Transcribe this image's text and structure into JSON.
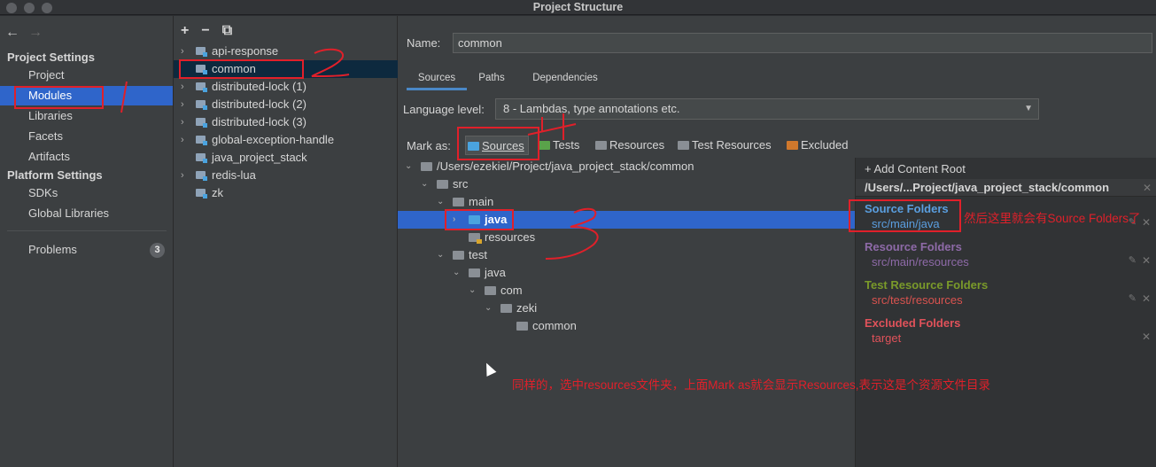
{
  "window": {
    "title": "Project Structure"
  },
  "nav": {
    "back": "←",
    "forward": "→",
    "project_settings_heading": "Project Settings",
    "project_settings": [
      "Project",
      "Modules",
      "Libraries",
      "Facets",
      "Artifacts"
    ],
    "selected": "Modules",
    "platform_settings_heading": "Platform Settings",
    "platform_settings": [
      "SDKs",
      "Global Libraries"
    ],
    "problems_label": "Problems",
    "problems_count": "3"
  },
  "modules": {
    "toolbar": {
      "add": "+",
      "remove": "−",
      "copy": "⧉"
    },
    "items": [
      {
        "label": "api-response",
        "expandable": true
      },
      {
        "label": "common",
        "expandable": false,
        "selected": true
      },
      {
        "label": "distributed-lock (1)",
        "expandable": true
      },
      {
        "label": "distributed-lock (2)",
        "expandable": true
      },
      {
        "label": "distributed-lock (3)",
        "expandable": true
      },
      {
        "label": "global-exception-handle",
        "expandable": true
      },
      {
        "label": "java_project_stack",
        "expandable": false
      },
      {
        "label": "redis-lua",
        "expandable": true
      },
      {
        "label": "zk",
        "expandable": false
      }
    ]
  },
  "module_detail": {
    "name_label": "Name:",
    "name_value": "common",
    "tabs": [
      "Sources",
      "Paths",
      "Dependencies"
    ],
    "active_tab": "Sources",
    "language_level_label": "Language level:",
    "language_level_value": "8 - Lambdas, type annotations etc.",
    "mark_as_label": "Mark as:",
    "mark_as": [
      {
        "label": "Sources",
        "color": "#4aa3df"
      },
      {
        "label": "Tests",
        "color": "#5aa34a"
      },
      {
        "label": "Resources",
        "color": "#8a8f95"
      },
      {
        "label": "Test Resources",
        "color": "#8a8f95"
      },
      {
        "label": "Excluded",
        "color": "#d0782c"
      }
    ]
  },
  "tree": [
    {
      "label": "/Users/ezekiel/Project/java_project_stack/common",
      "depth": 0
    },
    {
      "label": "src",
      "depth": 1
    },
    {
      "label": "main",
      "depth": 2
    },
    {
      "label": "java",
      "depth": 3,
      "selected": true
    },
    {
      "label": "resources",
      "depth": 3
    },
    {
      "label": "test",
      "depth": 2
    },
    {
      "label": "java",
      "depth": 3
    },
    {
      "label": "com",
      "depth": 4
    },
    {
      "label": "zeki",
      "depth": 5
    },
    {
      "label": "common",
      "depth": 6
    }
  ],
  "content_roots": {
    "add_label": "+ Add Content Root",
    "root_path": "/Users/...Project/java_project_stack/common",
    "sections": [
      {
        "title": "Source Folders",
        "path": "src/main/java",
        "title_color": "#5a9fe0",
        "path_color": "#5a9fe0"
      },
      {
        "title": "Resource Folders",
        "path": "src/main/resources",
        "title_color": "#8e6aa8",
        "path_color": "#8e6aa8"
      },
      {
        "title": "Test Resource Folders",
        "path": "src/test/resources",
        "title_color": "#7a9a2a",
        "path_color": "#d9534f"
      },
      {
        "title": "Excluded Folders",
        "path": "target",
        "title_color": "#e0525a",
        "path_color": "#e0525a"
      }
    ]
  },
  "annotations": {
    "note_right": "然后这里就会有Source Folders了",
    "note_bottom": "同样的，选中resources文件夹，上面Mark as就会显示Resources,表示这是个资源文件目录",
    "color": "#e0202a"
  }
}
